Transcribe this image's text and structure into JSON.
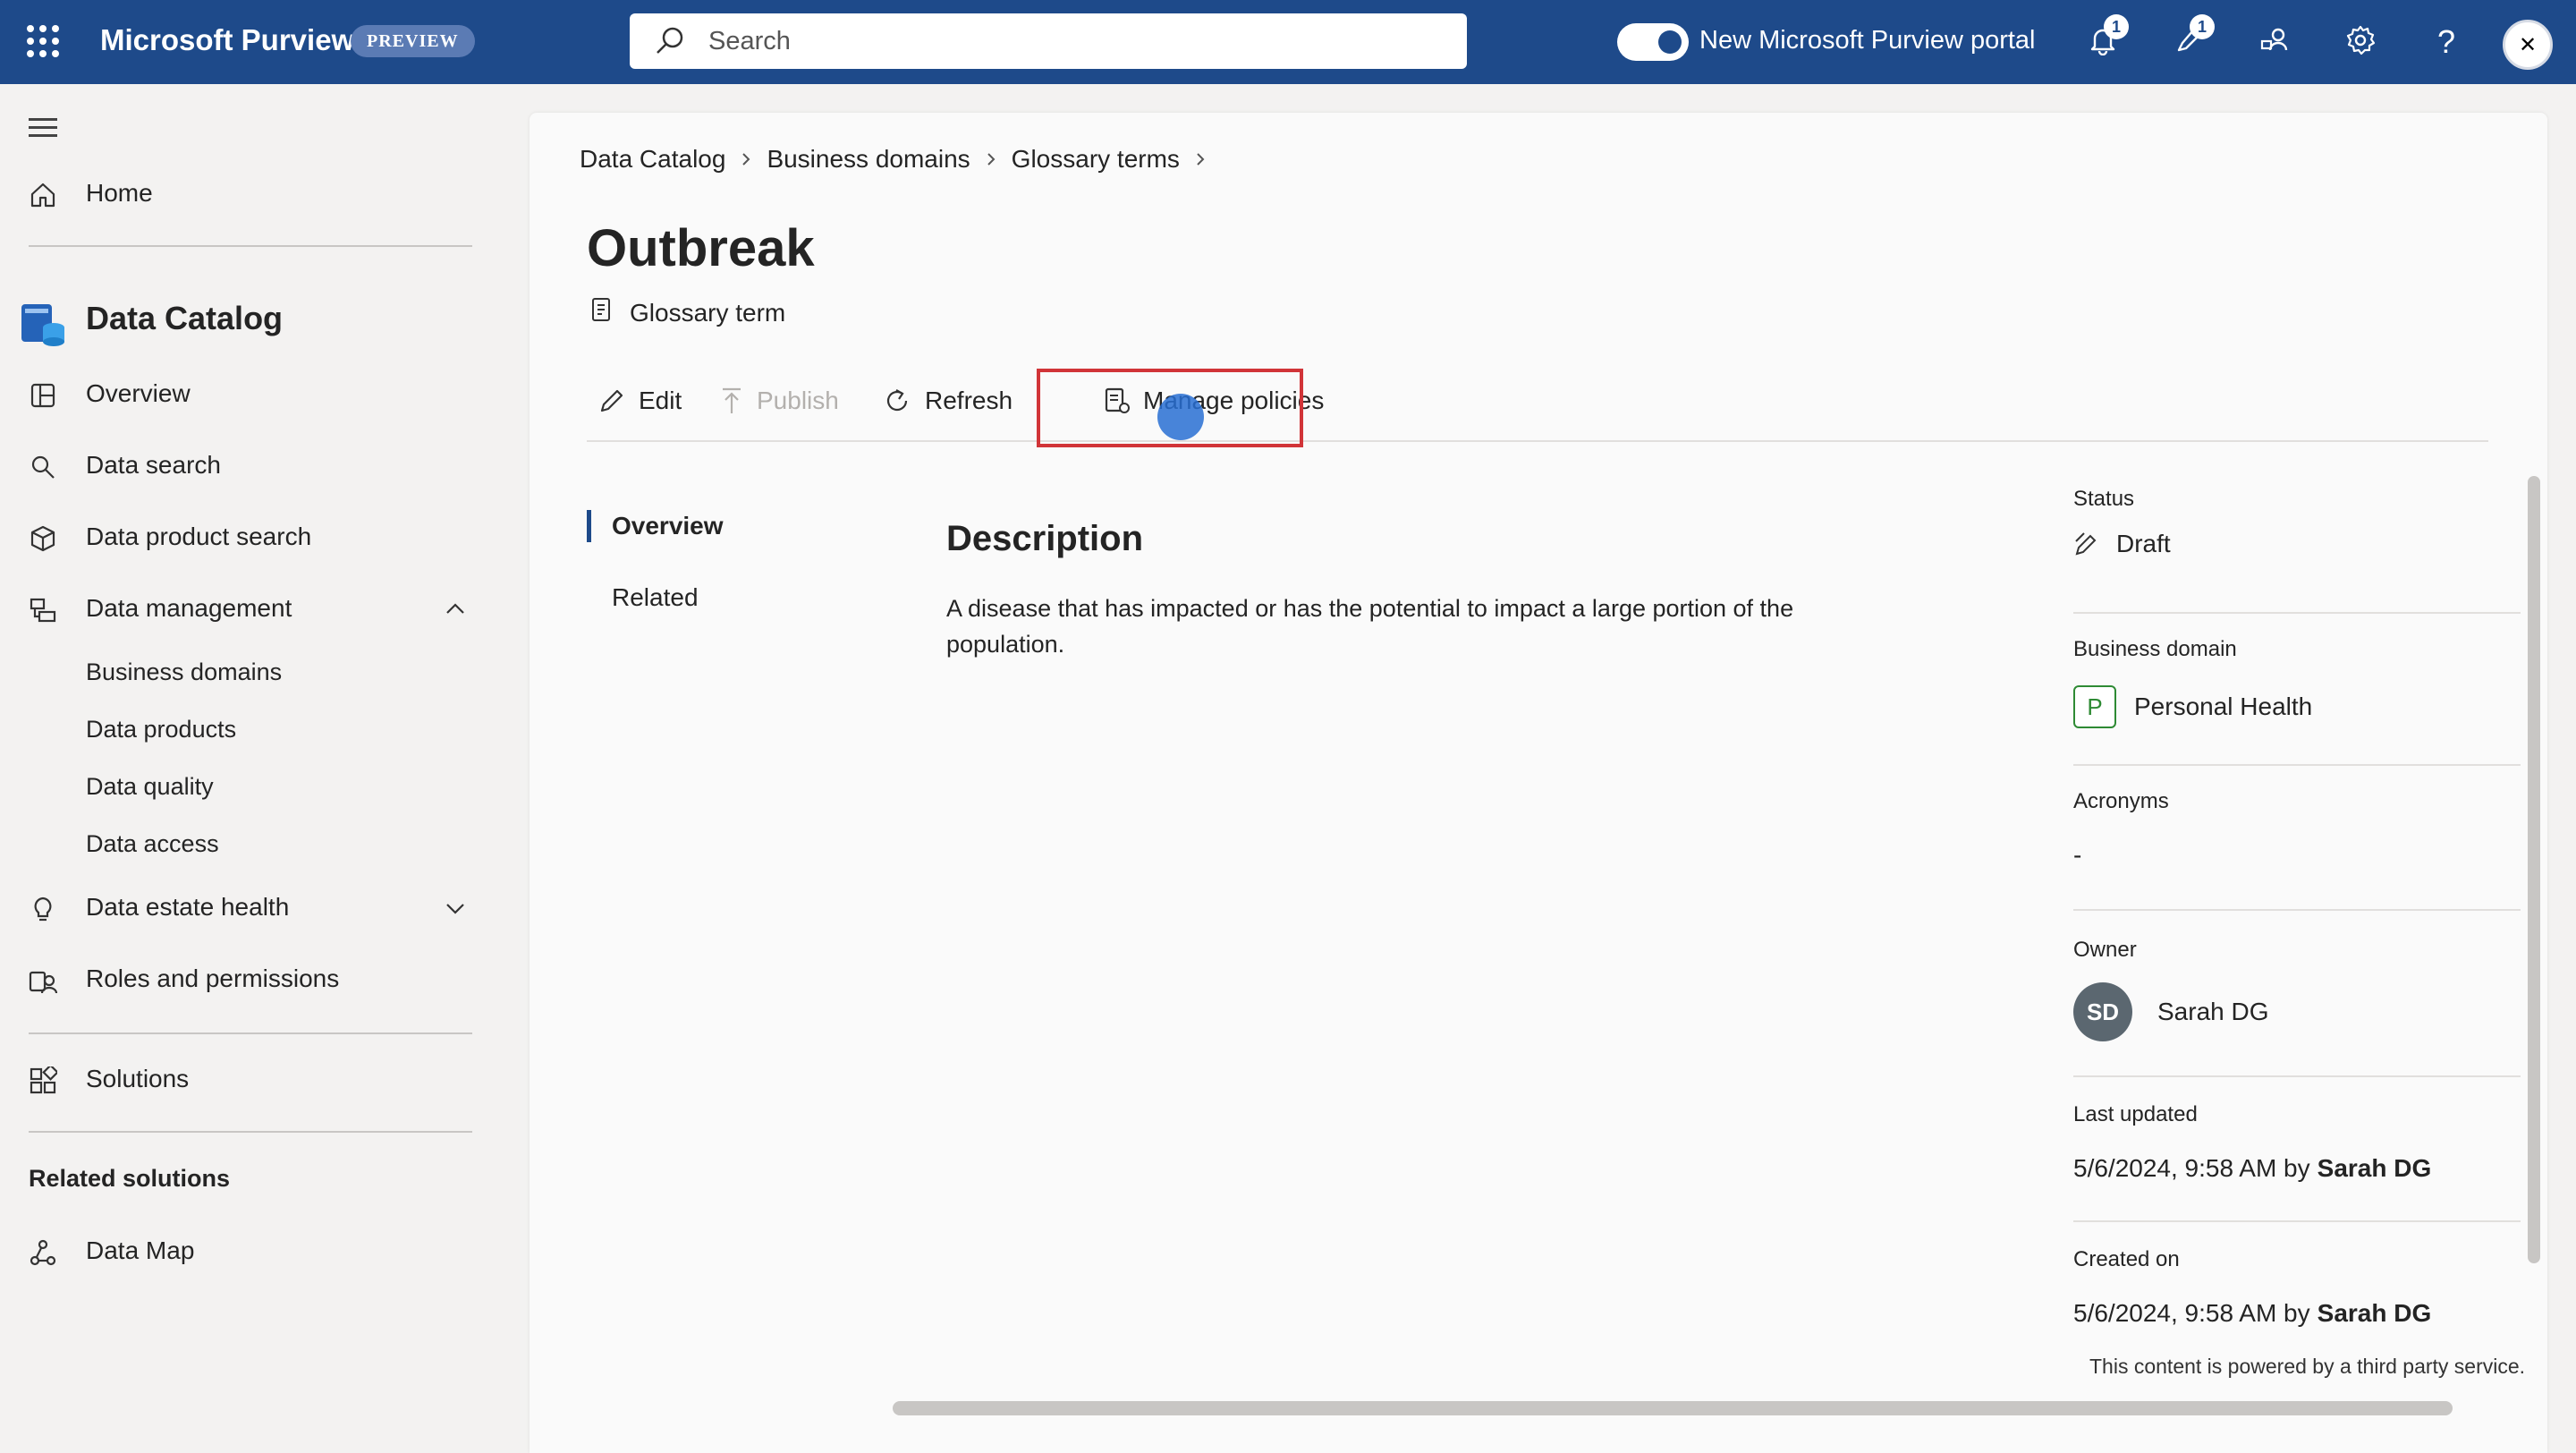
{
  "topbar": {
    "app_title": "Microsoft Purview",
    "preview_badge": "PREVIEW",
    "search_placeholder": "Search",
    "portal_toggle_label": "New Microsoft Purview portal",
    "notifications_count": "1",
    "feedback_count": "1",
    "accent_color": "#1e4a8a",
    "icons": [
      "waffle-icon",
      "search-icon",
      "bell-icon",
      "feedback-icon",
      "community-icon",
      "gear-icon",
      "help-icon",
      "avatar-icon"
    ]
  },
  "sidebar": {
    "home": "Home",
    "section_title": "Data Catalog",
    "items": [
      {
        "label": "Overview"
      },
      {
        "label": "Data search"
      },
      {
        "label": "Data product search"
      },
      {
        "label": "Data management"
      }
    ],
    "data_management_children": [
      "Business domains",
      "Data products",
      "Data quality",
      "Data access"
    ],
    "data_estate_health": "Data estate health",
    "roles_permissions": "Roles and permissions",
    "solutions": "Solutions",
    "related_solutions_heading": "Related solutions",
    "data_map": "Data Map"
  },
  "main": {
    "breadcrumb": [
      "Data Catalog",
      "Business domains",
      "Glossary terms"
    ],
    "title": "Outbreak",
    "subtype": "Glossary term",
    "toolbar": {
      "edit": "Edit",
      "publish": "Publish",
      "refresh": "Refresh",
      "manage_policies": "Manage policies"
    },
    "left_nav": [
      "Overview",
      "Related"
    ],
    "description_title": "Description",
    "description_text": "A disease that has impacted or has the potential to impact a large portion of the population.",
    "properties": {
      "status_label": "Status",
      "status_value": "Draft",
      "domain_label": "Business domain",
      "domain_initial": "P",
      "domain_value": "Personal Health",
      "acronyms_label": "Acronyms",
      "acronyms_value": "-",
      "owner_label": "Owner",
      "owner_initials": "SD",
      "owner_name": "Sarah DG",
      "updated_label": "Last updated",
      "updated_value": "5/6/2024, 9:58 AM by",
      "updated_by": "Sarah DG",
      "created_label": "Created on",
      "created_value": "5/6/2024, 9:58 AM by",
      "created_by": "Sarah DG"
    },
    "third_party_note": "This content is powered by a third party service."
  }
}
